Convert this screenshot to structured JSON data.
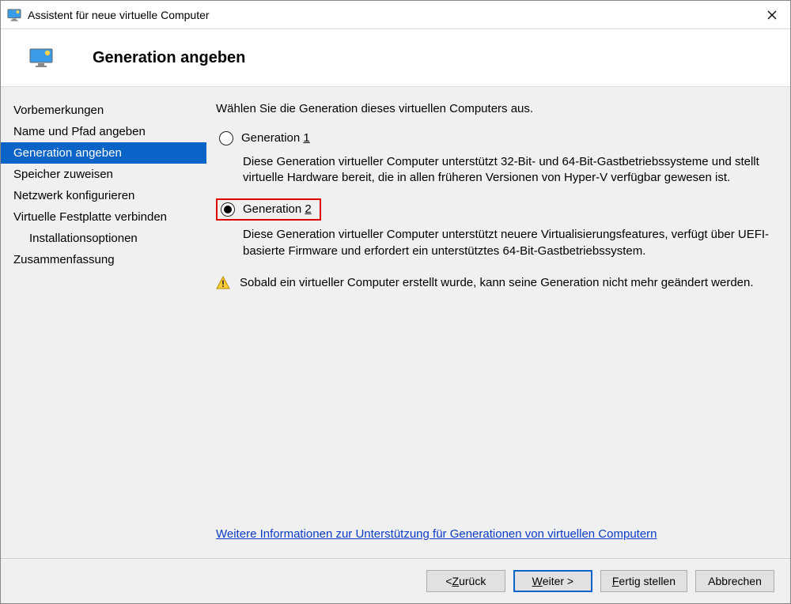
{
  "window": {
    "title": "Assistent für neue virtuelle Computer"
  },
  "header": {
    "page_title": "Generation angeben"
  },
  "sidebar": {
    "items": [
      {
        "label": "Vorbemerkungen"
      },
      {
        "label": "Name und Pfad angeben"
      },
      {
        "label": "Generation angeben"
      },
      {
        "label": "Speicher zuweisen"
      },
      {
        "label": "Netzwerk konfigurieren"
      },
      {
        "label": "Virtuelle Festplatte verbinden"
      },
      {
        "label": "Installationsoptionen"
      },
      {
        "label": "Zusammenfassung"
      }
    ],
    "active_index": 2,
    "indent_indices": [
      6
    ]
  },
  "content": {
    "intro": "Wählen Sie die Generation dieses virtuellen Computers aus.",
    "option1": {
      "label_pre": "Generation ",
      "label_key": "1",
      "desc": "Diese Generation virtueller Computer unterstützt 32-Bit- und 64-Bit-Gastbetriebssysteme und stellt virtuelle Hardware bereit, die in allen früheren Versionen von Hyper-V verfügbar gewesen ist."
    },
    "option2": {
      "label_pre": "Generation ",
      "label_key": "2",
      "desc": "Diese Generation virtueller Computer unterstützt neuere Virtualisierungsfeatures, verfügt über UEFI-basierte Firmware und erfordert ein unterstütztes 64-Bit-Gastbetriebssystem."
    },
    "warning": "Sobald ein virtueller Computer erstellt wurde, kann seine Generation nicht mehr geändert werden.",
    "help_link": "Weitere Informationen zur Unterstützung für Generationen von virtuellen Computern"
  },
  "footer": {
    "back_pre": "< ",
    "back_key": "Z",
    "back_post": "urück",
    "next_key": "W",
    "next_post": "eiter >",
    "finish_key": "F",
    "finish_post": "ertig stellen",
    "cancel": "Abbrechen"
  }
}
